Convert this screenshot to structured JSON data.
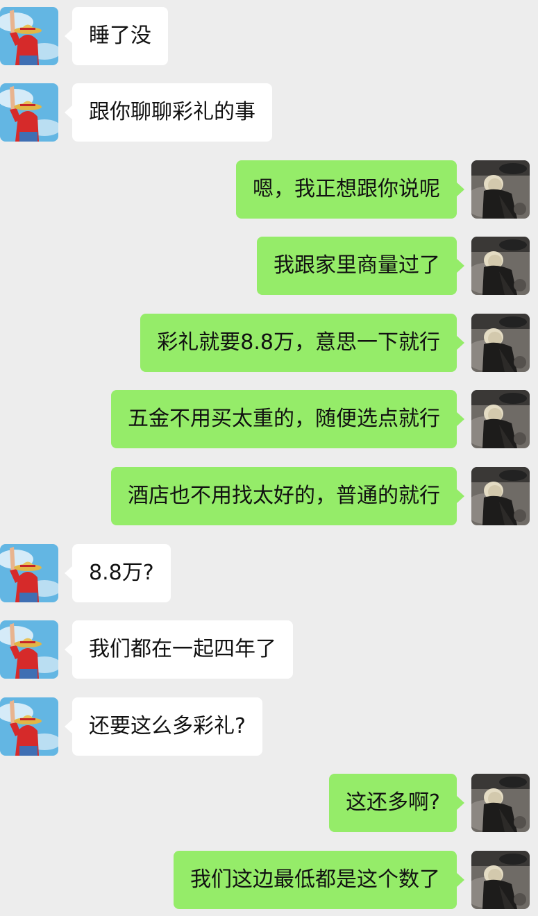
{
  "theme": {
    "background": "#ededed",
    "incoming_bubble": "#ffffff",
    "outgoing_bubble": "#95ec69",
    "text": "#111111"
  },
  "avatars": {
    "contact": "straw-hat-character-avatar",
    "self": "dark-photo-avatar"
  },
  "messages": [
    {
      "side": "left",
      "text": "睡了没"
    },
    {
      "side": "left",
      "text": "跟你聊聊彩礼的事"
    },
    {
      "side": "right",
      "text": "嗯，我正想跟你说呢"
    },
    {
      "side": "right",
      "text": "我跟家里商量过了"
    },
    {
      "side": "right",
      "text": "彩礼就要8.8万，意思一下就行"
    },
    {
      "side": "right",
      "text": "五金不用买太重的，随便选点就行"
    },
    {
      "side": "right",
      "text": "酒店也不用找太好的，普通的就行"
    },
    {
      "side": "left",
      "text": "8.8万?"
    },
    {
      "side": "left",
      "text": "我们都在一起四年了"
    },
    {
      "side": "left",
      "text": "还要这么多彩礼?"
    },
    {
      "side": "right",
      "text": "这还多啊?"
    },
    {
      "side": "right",
      "text": "我们这边最低都是这个数了"
    }
  ]
}
